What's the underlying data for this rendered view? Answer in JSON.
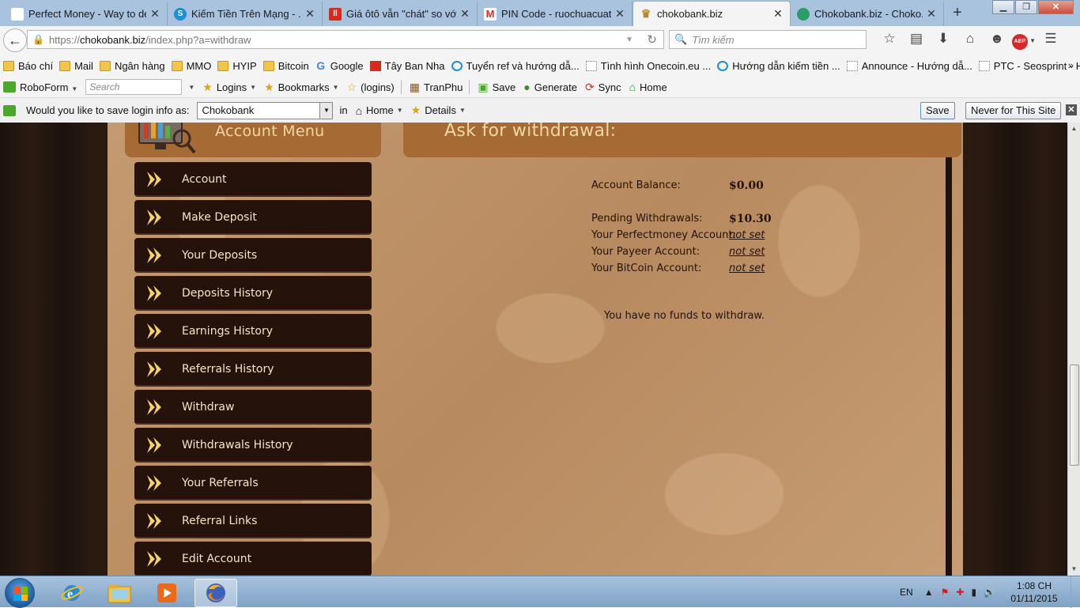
{
  "tabs": [
    {
      "title": "Perfect Money - Way to dev...",
      "icon": "perfectmoney-icon",
      "color": "#c4161c"
    },
    {
      "title": "Kiếm Tiền Trên Mạng - ...",
      "icon": "skype-icon",
      "color": "#1e8fd4"
    },
    {
      "title": "Giá ôtô vẫn \"chát\" so vớ...",
      "icon": "news-icon",
      "color": "#d62a1f"
    },
    {
      "title": "PIN Code - ruochuacuat...",
      "icon": "gmail-icon",
      "color": "#d93025"
    },
    {
      "title": "chokobank.biz",
      "icon": "crown-icon",
      "color": "#b8862a",
      "active": true
    },
    {
      "title": "Chokobank.biz - Choko...",
      "icon": "globe-icon",
      "color": "#2a9d6a"
    }
  ],
  "nav": {
    "url_scheme": "https://",
    "url_host": "chokobank.biz",
    "url_path": "/index.php?a=withdraw",
    "search_placeholder": "Tìm kiếm",
    "abp_label": "ABP"
  },
  "bookmarks": [
    {
      "label": "Báo chí",
      "icon": "folder"
    },
    {
      "label": "Mail",
      "icon": "folder"
    },
    {
      "label": "Ngân hàng",
      "icon": "folder"
    },
    {
      "label": "MMO",
      "icon": "folder"
    },
    {
      "label": "HYIP",
      "icon": "folder"
    },
    {
      "label": "Bitcoin",
      "icon": "folder"
    },
    {
      "label": "Google",
      "icon": "g"
    },
    {
      "label": "Tây Ban Nha",
      "icon": "red"
    },
    {
      "label": "Tuyển ref và hướng dẫ...",
      "icon": "sky"
    },
    {
      "label": "Tình hình Onecoin.eu ...",
      "icon": "blank"
    },
    {
      "label": "Hướng dẫn kiếm tiền ...",
      "icon": "sky"
    },
    {
      "label": "Announce - Hướng dẫ...",
      "icon": "blank"
    },
    {
      "label": "PTC - Seosprint - Hướ...",
      "icon": "blank"
    }
  ],
  "roboform": {
    "label": "RoboForm",
    "search_placeholder": "Search",
    "logins": "Logins",
    "bookmarks": "Bookmarks",
    "logins_paren": "(logins)",
    "tranphu": "TranPhu",
    "save": "Save",
    "generate": "Generate",
    "sync": "Sync",
    "home": "Home"
  },
  "save_login": {
    "prompt": "Would you like to save login info as:",
    "identity": "Chokobank",
    "in_label": "in",
    "folder": "Home",
    "details": "Details",
    "save_button": "Save",
    "never_button": "Never for This Site"
  },
  "page": {
    "account_menu_title": "Account Menu",
    "withdraw_title": "Ask for withdrawal:",
    "menu": [
      "Account",
      "Make Deposit",
      "Your Deposits",
      "Deposits History",
      "Earnings History",
      "Referrals History",
      "Withdraw",
      "Withdrawals History",
      "Your Referrals",
      "Referral Links",
      "Edit Account"
    ],
    "account_balance_label": "Account Balance:",
    "account_balance_value": "$0.00",
    "pending_label": "Pending Withdrawals:",
    "pending_value": "$10.30",
    "perfectmoney_label": "Your Perfectmoney Account:",
    "perfectmoney_value": "not set",
    "payeer_label": "Your Payeer Account:",
    "payeer_value": "not set",
    "bitcoin_label": "Your BitCoin Account:",
    "bitcoin_value": "not set",
    "no_funds": "You have no funds to withdraw."
  },
  "taskbar": {
    "lang": "EN",
    "time": "1:08 CH",
    "date": "01/11/2015"
  }
}
